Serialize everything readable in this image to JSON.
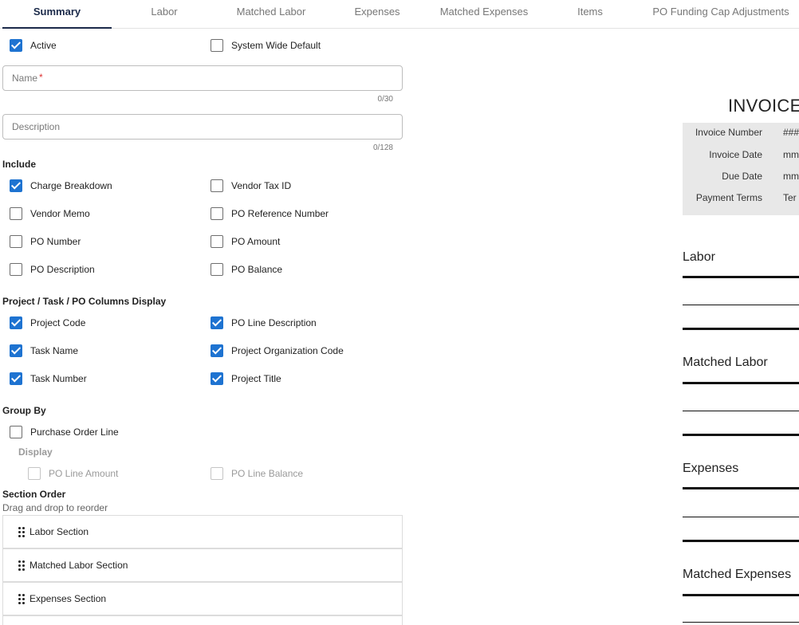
{
  "tabs": [
    "Summary",
    "Labor",
    "Matched Labor",
    "Expenses",
    "Matched Expenses",
    "Items",
    "PO Funding Cap Adjustments"
  ],
  "top_options": {
    "active": {
      "label": "Active",
      "checked": true
    },
    "system_default": {
      "label": "System Wide Default",
      "checked": false
    }
  },
  "name_field": {
    "placeholder": "Name",
    "required_mark": "*",
    "counter": "0/30"
  },
  "description_field": {
    "placeholder": "Description",
    "counter": "0/128"
  },
  "include": {
    "heading": "Include",
    "items": [
      {
        "label": "Charge Breakdown",
        "checked": true
      },
      {
        "label": "Vendor Tax ID",
        "checked": false
      },
      {
        "label": "Vendor Memo",
        "checked": false
      },
      {
        "label": "PO Reference Number",
        "checked": false
      },
      {
        "label": "PO Number",
        "checked": false
      },
      {
        "label": "PO Amount",
        "checked": false
      },
      {
        "label": "PO Description",
        "checked": false
      },
      {
        "label": "PO Balance",
        "checked": false
      }
    ]
  },
  "columns_display": {
    "heading": "Project / Task / PO Columns Display",
    "items": [
      {
        "label": "Project Code",
        "checked": true
      },
      {
        "label": "PO Line Description",
        "checked": true
      },
      {
        "label": "Task Name",
        "checked": true
      },
      {
        "label": "Project Organization Code",
        "checked": true
      },
      {
        "label": "Task Number",
        "checked": true
      },
      {
        "label": "Project Title",
        "checked": true
      }
    ]
  },
  "group_by": {
    "heading": "Group By",
    "purchase_order_line": {
      "label": "Purchase Order Line",
      "checked": false
    },
    "display_heading": "Display",
    "po_line_amount": {
      "label": "PO Line Amount",
      "checked": false
    },
    "po_line_balance": {
      "label": "PO Line Balance",
      "checked": false
    }
  },
  "section_order": {
    "heading": "Section Order",
    "hint": "Drag and drop to reorder",
    "items": [
      "Labor Section",
      "Matched Labor Section",
      "Expenses Section"
    ]
  },
  "preview": {
    "title": "INVOICE",
    "meta": [
      {
        "label": "Invoice Number",
        "value": "###"
      },
      {
        "label": "Invoice Date",
        "value": "mm"
      },
      {
        "label": "Due Date",
        "value": "mm"
      },
      {
        "label": "Payment Terms",
        "value": "Ter"
      }
    ],
    "sections": [
      "Labor",
      "Matched Labor",
      "Expenses",
      "Matched Expenses"
    ]
  },
  "colors": {
    "accent": "#1e73d1",
    "tab_active": "#1b2a4a",
    "preview_meta_bg": "#e8e8e8"
  },
  "icons": {
    "checkbox": "check-icon",
    "drag": "drag-handle-icon"
  }
}
